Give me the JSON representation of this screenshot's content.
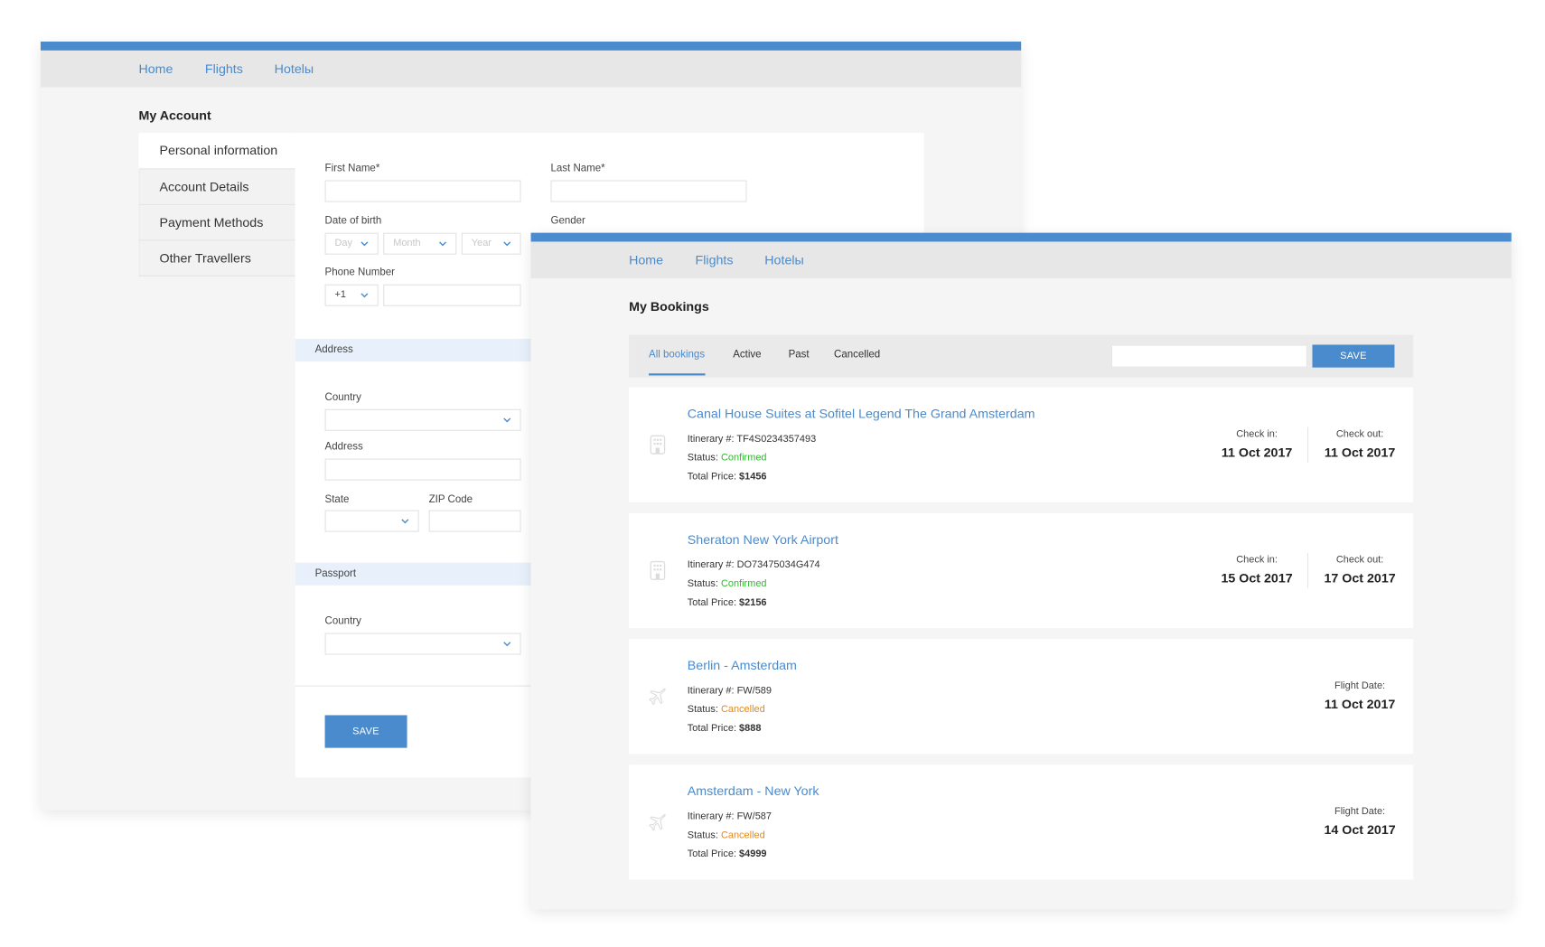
{
  "nav": {
    "home": "Home",
    "flights": "Flights",
    "hotels": "Hotelы"
  },
  "colors": {
    "accent": "#4a8bce",
    "confirmed": "#2bbd2b",
    "cancelled": "#e08a1e",
    "section_band": "#e8f1fb"
  },
  "account": {
    "title": "My Account",
    "sidebar": [
      {
        "label": "Personal information",
        "active": true
      },
      {
        "label": "Account Details"
      },
      {
        "label": "Payment Methods"
      },
      {
        "label": "Other Travellers"
      }
    ],
    "form": {
      "first_name_label": "First Name*",
      "first_name_value": "",
      "last_name_label": "Last Name*",
      "last_name_value": "",
      "dob_label": "Date of birth",
      "dob_day_placeholder": "Day",
      "dob_month_placeholder": "Month",
      "dob_year_placeholder": "Year",
      "gender_label": "Gender",
      "phone_label": "Phone Number",
      "phone_code": "+1",
      "phone_value": "",
      "address_section": "Address",
      "country_label": "Country",
      "address_label": "Address",
      "state_label": "State",
      "zip_label": "ZIP Code",
      "passport_section": "Passport",
      "passport_country_label": "Country",
      "save_label": "SAVE"
    }
  },
  "bookings": {
    "title": "My Bookings",
    "tabs": [
      {
        "label": "All bookings",
        "active": true
      },
      {
        "label": "Active"
      },
      {
        "label": "Past"
      },
      {
        "label": "Cancelled"
      }
    ],
    "search_value": "",
    "save_label": "SAVE",
    "itinerary_label": "Itinerary #:",
    "status_label": "Status:",
    "price_label": "Total Price:",
    "checkin_label": "Check in:",
    "checkout_label": "Check out:",
    "flight_date_label": "Flight Date:",
    "items": [
      {
        "type": "hotel",
        "icon": "hotel-building-icon",
        "title": "Canal House Suites at Sofitel Legend The Grand Amsterdam",
        "itinerary": "TF4S0234357493",
        "status": "Confirmed",
        "price": "$1456",
        "check_in": "11 Oct 2017",
        "check_out": "11 Oct 2017"
      },
      {
        "type": "hotel",
        "icon": "hotel-building-icon",
        "title": "Sheraton New York Airport",
        "itinerary": "DO73475034G474",
        "status": "Confirmed",
        "price": "$2156",
        "check_in": "15 Oct 2017",
        "check_out": "17 Oct 2017"
      },
      {
        "type": "flight",
        "icon": "airplane-icon",
        "title": "Berlin - Amsterdam",
        "itinerary": "FW/589",
        "status": "Cancelled",
        "price": "$888",
        "flight_date": "11 Oct 2017"
      },
      {
        "type": "flight",
        "icon": "airplane-icon",
        "title": "Amsterdam - New York",
        "itinerary": "FW/587",
        "status": "Cancelled",
        "price": "$4999",
        "flight_date": "14 Oct 2017"
      }
    ]
  }
}
